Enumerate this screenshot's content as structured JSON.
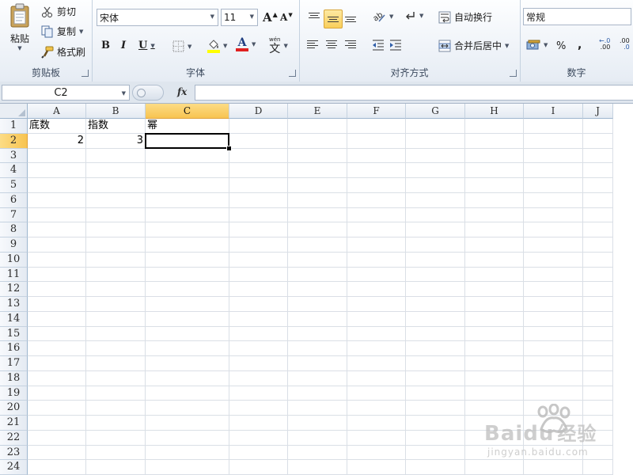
{
  "ribbon": {
    "clipboard": {
      "paste_label": "粘贴",
      "cut_label": "剪切",
      "copy_label": "复制",
      "format_painter_label": "格式刷",
      "group_label": "剪贴板",
      "icons": [
        "clipboard-icon",
        "scissors-icon",
        "copy-icon",
        "format-painter-icon"
      ]
    },
    "font": {
      "font_name": "宋体",
      "font_size": "11",
      "grow_label": "A",
      "shrink_label": "A",
      "bold_label": "B",
      "italic_label": "I",
      "underline_label": "U",
      "font_color_label": "A",
      "phonetic_label": "wén",
      "phonetic_char": "文",
      "group_label": "字体",
      "font_color": "#e02020",
      "fill_color": "#ffff00"
    },
    "alignment": {
      "wrap_text_label": "自动换行",
      "merge_center_label": "合并后居中",
      "group_label": "对齐方式"
    },
    "number": {
      "format_value": "常规",
      "percent_label": "%",
      "comma_label": ",",
      "increase_decimal_label": ".00",
      "decrease_decimal_label": ".0",
      "group_label": "数字"
    }
  },
  "formula_bar": {
    "name_box": "C2",
    "fx_label": "fx",
    "content": ""
  },
  "sheet": {
    "columns": [
      "A",
      "B",
      "C",
      "D",
      "E",
      "F",
      "G",
      "H",
      "I",
      "J"
    ],
    "rows": [
      "1",
      "2",
      "3",
      "4",
      "5",
      "6",
      "7",
      "8",
      "9",
      "10",
      "11",
      "12",
      "13",
      "14",
      "15",
      "16",
      "17",
      "18",
      "19",
      "20",
      "21",
      "22",
      "23",
      "24"
    ],
    "active_column": "C",
    "active_row": "2",
    "cells": {
      "A1": "底数",
      "B1": "指数",
      "C1": "幂",
      "A2": "2",
      "B2": "3"
    }
  },
  "watermark": {
    "brand": "Bai",
    "brand_suffix": "du",
    "product": "经验",
    "url": "jingyan.baidu.com"
  }
}
